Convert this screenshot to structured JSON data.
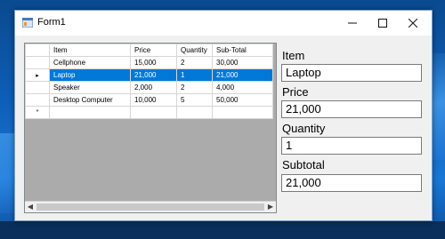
{
  "window": {
    "title": "Form1"
  },
  "grid": {
    "columns": [
      "Item",
      "Price",
      "Quantity",
      "Sub-Total"
    ],
    "rows": [
      [
        "Cellphone",
        "15,000",
        "2",
        "30,000"
      ],
      [
        "Laptop",
        "21,000",
        "1",
        "21,000"
      ],
      [
        "Speaker",
        "2,000",
        "2",
        "4,000"
      ],
      [
        "Desktop Computer",
        "10,000",
        "5",
        "50,000"
      ]
    ],
    "selected_row": 1,
    "current_row_marker": "▸",
    "new_row_marker": "*"
  },
  "form": {
    "item_label": "Item",
    "item_value": "Laptop",
    "price_label": "Price",
    "price_value": "21,000",
    "quantity_label": "Quantity",
    "quantity_value": "1",
    "subtotal_label": "Subtotal",
    "subtotal_value": "21,000"
  }
}
